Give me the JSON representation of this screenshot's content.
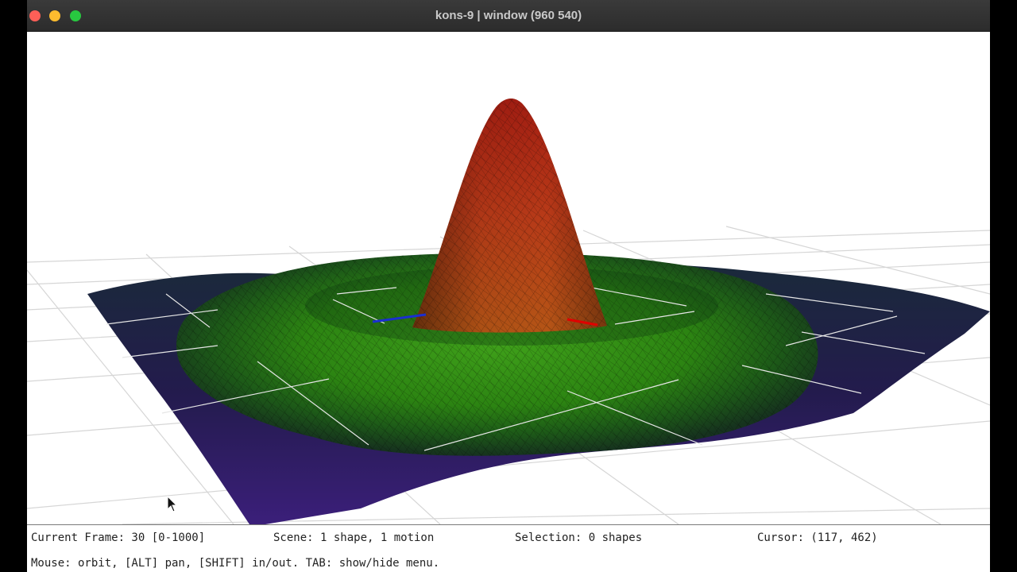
{
  "window": {
    "title": "kons-9 | window (960 540)"
  },
  "status": {
    "frame": "Current Frame: 30 [0-1000]",
    "scene": "Scene: 1 shape, 1 motion",
    "selection": "Selection: 0 shapes",
    "cursor": "Cursor: (117, 462)",
    "help": "Mouse: orbit, [ALT] pan, [SHIFT] in/out. TAB: show/hide menu."
  },
  "scene": {
    "surface_colors": {
      "peak": "#c0321a",
      "ring": "#2f8a12",
      "edge": "#2b1a66",
      "grid": "#d9d9d9",
      "axis_x": "#e00000",
      "axis_z": "#1a2fd0"
    }
  }
}
